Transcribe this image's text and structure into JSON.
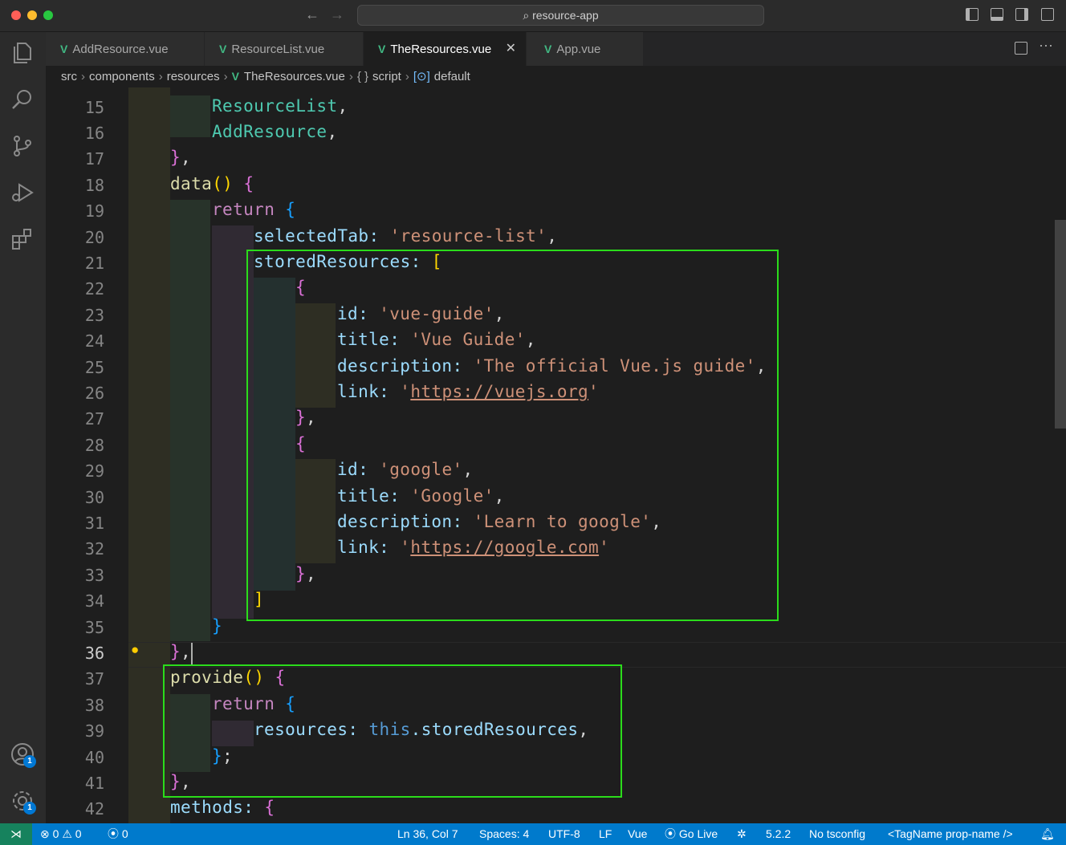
{
  "window": {
    "command_center": "resource-app"
  },
  "tabs": [
    {
      "label": "AddResource.vue",
      "active": false
    },
    {
      "label": "ResourceList.vue",
      "active": false
    },
    {
      "label": "TheResources.vue",
      "active": true
    },
    {
      "label": "App.vue",
      "active": false
    }
  ],
  "breadcrumb": {
    "items": [
      "src",
      "components",
      "resources",
      "TheResources.vue",
      "script",
      "default"
    ]
  },
  "editor": {
    "line_numbers": [
      "15",
      "16",
      "17",
      "18",
      "19",
      "20",
      "21",
      "22",
      "23",
      "24",
      "25",
      "26",
      "27",
      "28",
      "29",
      "30",
      "31",
      "32",
      "33",
      "34",
      "35",
      "36",
      "37",
      "38",
      "39",
      "40",
      "41",
      "42"
    ],
    "current_line": "36",
    "code": {
      "l15_a": "ResourceList",
      "l15_b": ",",
      "l16_a": "AddResource",
      "l16_b": ",",
      "l17_a": "}",
      "l17_b": ",",
      "l18_a": "data",
      "l18_b": "()",
      "l18_c": " {",
      "l19_a": "return",
      "l19_b": " {",
      "l20_a": "selectedTab: ",
      "l20_b": "'resource-list'",
      "l20_c": ",",
      "l21_a": "storedResources: ",
      "l21_b": "[",
      "l22_a": "{",
      "l23_a": "id: ",
      "l23_b": "'vue-guide'",
      "l23_c": ",",
      "l24_a": "title: ",
      "l24_b": "'Vue Guide'",
      "l24_c": ",",
      "l25_a": "description: ",
      "l25_b": "'The official Vue.js guide'",
      "l25_c": ",",
      "l26_a": "link: ",
      "l26_b": "'",
      "l26_c": "https://vuejs.org",
      "l26_d": "'",
      "l27_a": "}",
      "l27_b": ",",
      "l28_a": "{",
      "l29_a": "id: ",
      "l29_b": "'google'",
      "l29_c": ",",
      "l30_a": "title: ",
      "l30_b": "'Google'",
      "l30_c": ",",
      "l31_a": "description: ",
      "l31_b": "'Learn to google'",
      "l31_c": ",",
      "l32_a": "link: ",
      "l32_b": "'",
      "l32_c": "https://google.com",
      "l32_d": "'",
      "l33_a": "}",
      "l33_b": ",",
      "l34_a": "]",
      "l35_a": "}",
      "l36_a": "}",
      "l36_b": ",",
      "l37_a": "provide",
      "l37_b": "()",
      "l37_c": " {",
      "l38_a": "return",
      "l38_b": " {",
      "l39_a": "resources: ",
      "l39_b": "this",
      "l39_c": ".storedResources",
      "l39_d": ",",
      "l40_a": "}",
      "l40_b": ";",
      "l41_a": "}",
      "l41_b": ",",
      "l42_a": "methods: ",
      "l42_b": "{"
    }
  },
  "activity_bar": {
    "icons": [
      "explorer-icon",
      "search-icon",
      "source-control-icon",
      "run-debug-icon",
      "extensions-icon",
      "accounts-icon",
      "settings-icon"
    ],
    "accounts_badge": "1",
    "settings_badge": "1"
  },
  "statusbar": {
    "errors": "0",
    "warnings": "0",
    "ports": "0",
    "position": "Ln 36, Col 7",
    "spaces": "Spaces: 4",
    "encoding": "UTF-8",
    "eol": "LF",
    "language": "Vue",
    "go_live": "Go Live",
    "version": "5.2.2",
    "tsconfig": "No tsconfig",
    "tag_name": "<TagName prop-name />"
  },
  "colors": {
    "accent": "#007acc",
    "highlight_box": "#2bdc1b",
    "vue_green": "#41b883"
  }
}
